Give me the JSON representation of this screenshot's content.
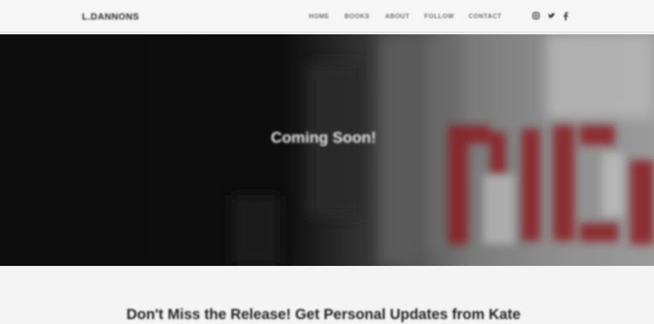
{
  "header": {
    "logo_text": "L.DANNONS",
    "nav": [
      {
        "label": "HOME"
      },
      {
        "label": "BOOKS"
      },
      {
        "label": "ABOUT"
      },
      {
        "label": "FOLLOW"
      },
      {
        "label": "CONTACT"
      }
    ],
    "social_icons": [
      "instagram-icon",
      "twitter-icon",
      "facebook-icon"
    ]
  },
  "hero": {
    "title": "Coming Soon!",
    "accent_color": "#8a1f22",
    "background_color": "#0c0c0c"
  },
  "signup": {
    "heading": "Don't Miss the Release! Get Personal Updates from Kate"
  }
}
